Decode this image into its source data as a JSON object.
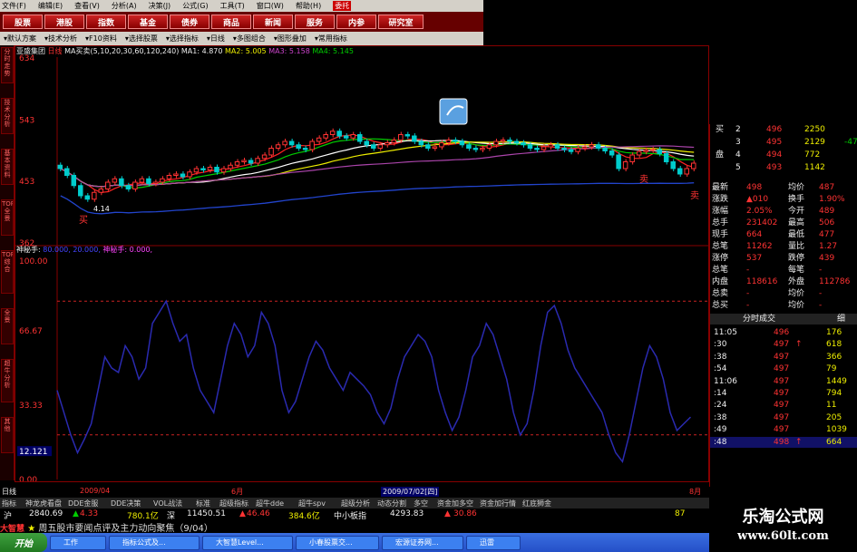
{
  "menubar": [
    "文件(F)",
    "编辑(E)",
    "查看(V)",
    "分析(A)",
    "决策(J)",
    "公式(G)",
    "工具(T)",
    "窗口(W)",
    "帮助(H)"
  ],
  "menubar_trust": "委托",
  "top_buttons": [
    "股票",
    "港股",
    "指数",
    "基金",
    "债券",
    "商品",
    "新闻",
    "服务",
    "内参",
    "研究室"
  ],
  "toolbar2": [
    "默认方案",
    "技术分析",
    "F10资料",
    "选择股票",
    "选择指标",
    "日线",
    "多图组合",
    "图形叠加",
    "常用指标"
  ],
  "left_tabs": [
    "分时走势",
    "技术分析",
    "基本资料",
    "TOP全景",
    "TOP综合",
    "全景",
    "超牛分析",
    "其他"
  ],
  "chart_info": {
    "stock": "亚盛集团",
    "period": "日线",
    "ma_label": "MA买卖(5,10,20,30,60,120,240)",
    "ma1": "MA1: 4.870",
    "ma2": "MA2: 5.005",
    "ma3": "MA3: 5.158",
    "ma4": "MA4: 5.145"
  },
  "ind2_info": {
    "name": "神秘手:",
    "vals": "80.000, 20.000, ",
    "last": "神秘手: 0.000,"
  },
  "y_labels_top": [
    "634",
    "543",
    "453",
    "362"
  ],
  "y_labels_bottom": [
    "100.00",
    "66.67",
    "33.33",
    "12.121",
    "0.00"
  ],
  "signals": {
    "buy": "买",
    "sell": "卖",
    "price_low": "4.14"
  },
  "chart_data": [
    {
      "type": "candlestick",
      "title": "亚盛集团 日线",
      "ylim": [
        362,
        634
      ],
      "ma_values": {
        "MA1": 4.87,
        "MA2": 5.005,
        "MA3": 5.158,
        "MA4": 5.145
      },
      "x": [
        1,
        2,
        3,
        4,
        5,
        6,
        7,
        8,
        9,
        10,
        11,
        12,
        13,
        14,
        15,
        16,
        17,
        18,
        19,
        20,
        21,
        22,
        23,
        24,
        25,
        26,
        27,
        28,
        29,
        30,
        31,
        32,
        33,
        34,
        35,
        36,
        37,
        38,
        39,
        40,
        41,
        42,
        43,
        44,
        45,
        46,
        47,
        48,
        49,
        50,
        51,
        52,
        53,
        54,
        55,
        56,
        57,
        58,
        59,
        60,
        61,
        62,
        63,
        64,
        65,
        66,
        67,
        68,
        69,
        70,
        71,
        72,
        73,
        74,
        75,
        76,
        77,
        78,
        79,
        80,
        81,
        82,
        83,
        84,
        85,
        86,
        87,
        88,
        89,
        90,
        91,
        92,
        93,
        94
      ],
      "close": [
        470,
        460,
        445,
        430,
        425,
        435,
        440,
        450,
        455,
        445,
        440,
        450,
        455,
        448,
        450,
        455,
        460,
        462,
        458,
        465,
        470,
        468,
        472,
        465,
        470,
        475,
        480,
        482,
        478,
        485,
        490,
        500,
        505,
        510,
        505,
        500,
        498,
        510,
        515,
        520,
        525,
        518,
        515,
        520,
        510,
        505,
        500,
        505,
        508,
        512,
        520,
        518,
        510,
        505,
        500,
        502,
        508,
        512,
        510,
        505,
        500,
        498,
        500,
        505,
        510,
        512,
        510,
        508,
        505,
        500,
        498,
        502,
        505,
        500,
        498,
        495,
        500,
        502,
        505,
        500,
        496,
        490,
        470,
        480,
        490,
        495,
        497,
        498,
        492,
        480,
        470,
        462,
        470,
        478
      ]
    },
    {
      "type": "line",
      "title": "神秘手",
      "ylim": [
        0,
        100
      ],
      "ref_lines": [
        80,
        20
      ],
      "values": [
        40,
        30,
        20,
        12,
        18,
        25,
        40,
        55,
        50,
        48,
        60,
        55,
        45,
        50,
        70,
        75,
        80,
        70,
        62,
        65,
        50,
        40,
        35,
        30,
        45,
        60,
        70,
        65,
        55,
        60,
        75,
        70,
        60,
        40,
        30,
        35,
        45,
        55,
        62,
        58,
        50,
        45,
        40,
        48,
        45,
        42,
        38,
        30,
        25,
        32,
        45,
        55,
        60,
        65,
        62,
        55,
        40,
        30,
        22,
        28,
        40,
        55,
        60,
        70,
        65,
        55,
        45,
        30,
        20,
        25,
        40,
        60,
        75,
        78,
        70,
        58,
        50,
        45,
        40,
        35,
        30,
        20,
        12,
        8,
        20,
        35,
        50,
        60,
        55,
        45,
        30,
        22,
        25,
        28
      ]
    }
  ],
  "right_panel": {
    "book": [
      {
        "side": "买",
        "n": "2",
        "price": "496",
        "vol": "2250",
        "chg": ""
      },
      {
        "side": "",
        "n": "3",
        "price": "495",
        "vol": "2129",
        "chg": "-47"
      },
      {
        "side": "盘",
        "n": "4",
        "price": "494",
        "vol": "772",
        "chg": ""
      },
      {
        "side": "",
        "n": "5",
        "price": "493",
        "vol": "1142",
        "chg": ""
      }
    ],
    "stats": [
      [
        "最新",
        "498",
        "均价",
        "487"
      ],
      [
        "涨跌",
        "▲010",
        "换手",
        "1.90%"
      ],
      [
        "涨幅",
        "2.05%",
        "今开",
        "489"
      ],
      [
        "总手",
        "231402",
        "最高",
        "506"
      ],
      [
        "现手",
        "664",
        "最低",
        "477"
      ],
      [
        "总笔",
        "11262",
        "量比",
        "1.27"
      ],
      [
        "涨停",
        "537",
        "跌停",
        "439"
      ],
      [
        "总笔",
        "-",
        "每笔",
        "-"
      ],
      [
        "内盘",
        "118616",
        "外盘",
        "112786"
      ],
      [
        "总卖",
        "-",
        "均价",
        "-"
      ],
      [
        "总买",
        "-",
        "均价",
        "-"
      ]
    ],
    "ticks_title": "分时成交",
    "ticks_btn": "细",
    "ticks": [
      [
        "11:05",
        "496",
        "",
        "176"
      ],
      [
        ":30",
        "497",
        "↑",
        "618"
      ],
      [
        ":38",
        "497",
        "",
        "366"
      ],
      [
        ":54",
        "497",
        "",
        "79"
      ],
      [
        "11:06",
        "497",
        "",
        "1449"
      ],
      [
        ":14",
        "497",
        "",
        "794"
      ],
      [
        ":24",
        "497",
        "",
        "11"
      ],
      [
        ":38",
        "497",
        "",
        "205"
      ],
      [
        ":49",
        "497",
        "",
        "1039"
      ],
      [
        ":48",
        "498",
        "↑",
        "664"
      ]
    ]
  },
  "x_labels": [
    "2009/04",
    "6月",
    "7月",
    "8月"
  ],
  "x_date_box": "2009/07/02[四]",
  "bottom_left": "日线",
  "tabs_row": [
    "指标",
    "神龙虎看盘",
    "DDE金服",
    "DDE决策",
    "VOL战法",
    "标准",
    "超级指标",
    "超牛dde",
    "超牛spv",
    "超级分析",
    "动态分割",
    "多空",
    "资金加多空",
    "资金加行情",
    "红底狮金"
  ],
  "ticker": {
    "sh_label": "沪",
    "sh": "2840.69",
    "sh_chg": "4.33",
    "sh_amt": "780.1亿",
    "sz_label": "深",
    "sz": "11450.51",
    "sz_chg": "46.46",
    "sz_amt": "384.6亿",
    "sm_label": "中小板指",
    "sm": "4293.83",
    "sm_chg": "30.86",
    "last": "87"
  },
  "news": {
    "brand": "大智慧",
    "text": "周五股市要闻点评及主力动向聚焦（9/04）"
  },
  "taskbar": {
    "start": "开始",
    "tasks": [
      "工作",
      "指标公式及...",
      "大智慧Level...",
      "小春股票交...",
      "宏源证券网...",
      "迅雷"
    ]
  },
  "watermark": {
    "line1": "乐淘公式网",
    "line2": "www.60lt.com"
  },
  "colors": {
    "bg": "#000000",
    "up": "#ff3333",
    "down": "#00cccc",
    "ma_red": "#ff2222",
    "ma_white": "#ffffff",
    "ma_green": "#00cc00",
    "ma_yellow": "#eeee00",
    "ma_purple": "#aa44aa",
    "ma_blue": "#2244cc",
    "ind_line": "#2a2ab0",
    "ref_line": "#cc2222"
  }
}
